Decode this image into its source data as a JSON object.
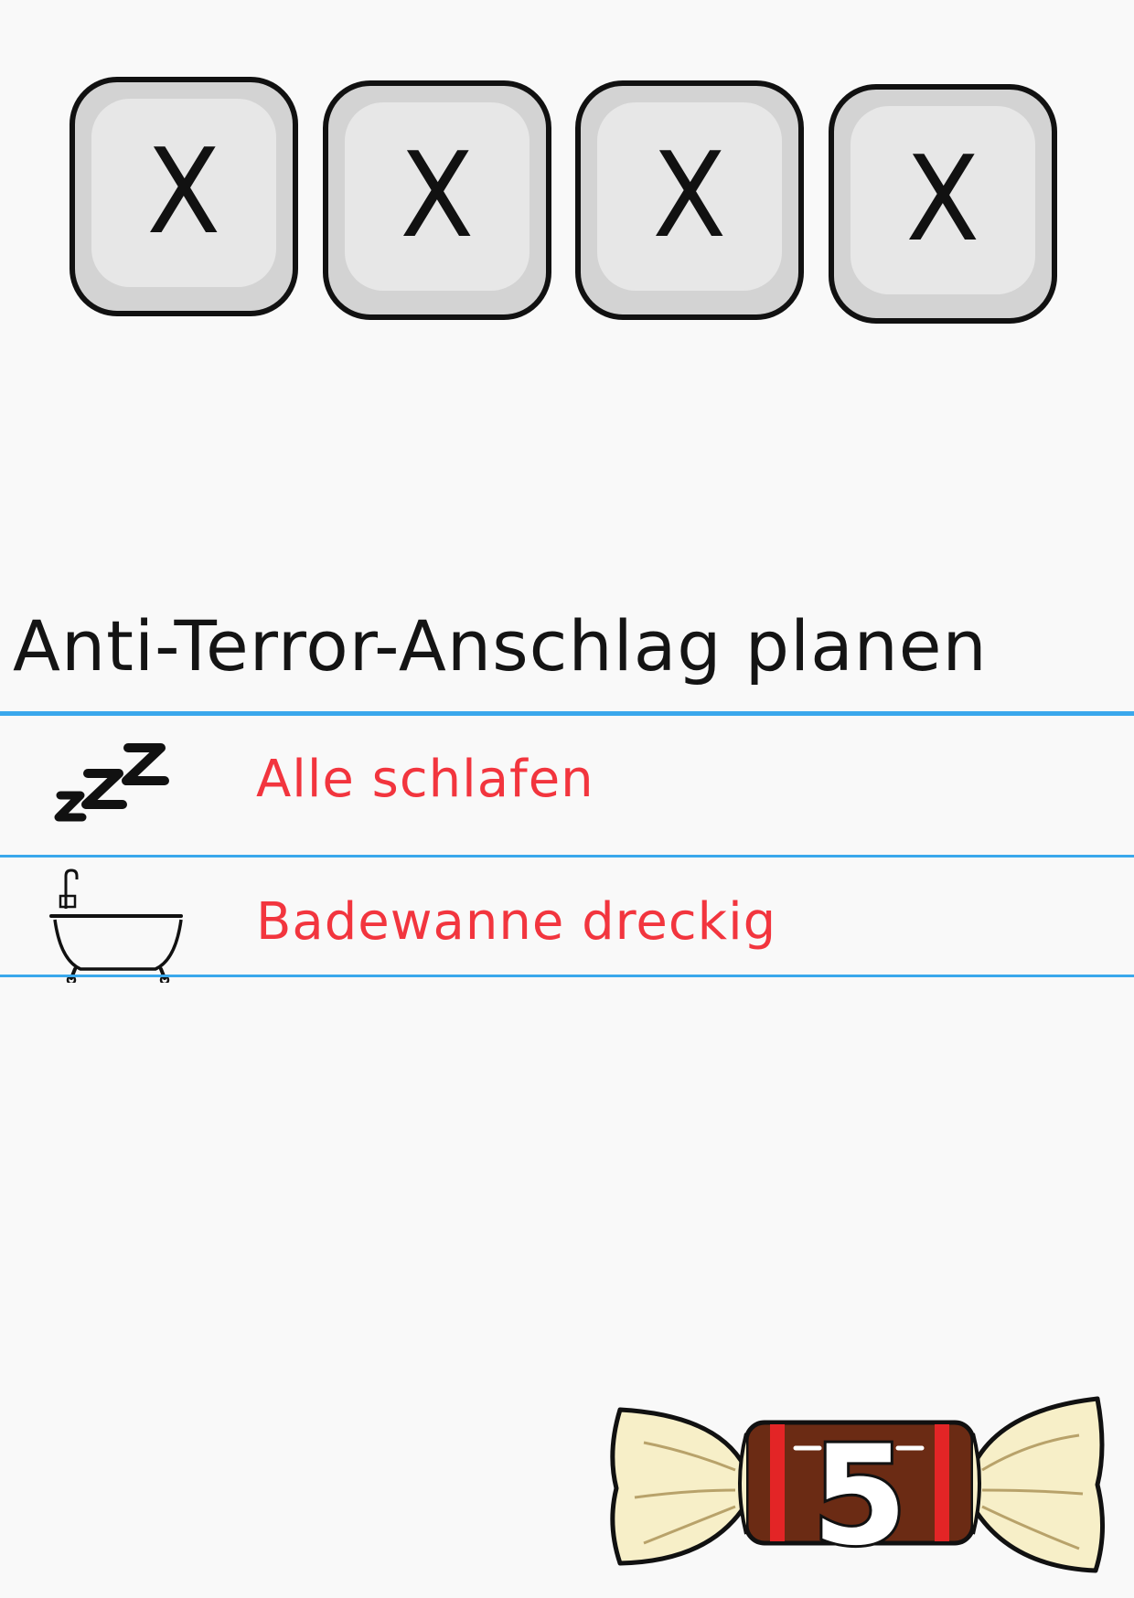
{
  "keys": [
    "X",
    "X",
    "X",
    "X"
  ],
  "title": "Anti-Terror-Anschlag planen",
  "rows": [
    {
      "icon": "sleep-zzz-icon",
      "text": "Alle schlafen"
    },
    {
      "icon": "bathtub-icon",
      "text": "Badewanne dreckig"
    }
  ],
  "candy": {
    "value": "5"
  },
  "colors": {
    "line": "#3aa8ec",
    "row_text": "#f2353e",
    "key_outer": "#d3d3d3",
    "key_inner": "#e7e7e7",
    "candy_wrapper": "#f7efc8",
    "candy_body": "#6b2b14",
    "candy_band": "#e32526"
  }
}
